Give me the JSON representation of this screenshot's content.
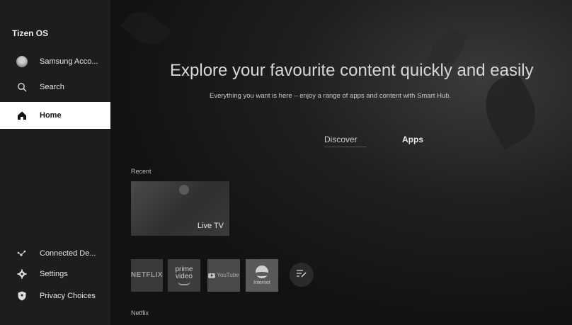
{
  "sidebar": {
    "os_title": "Tizen OS",
    "account_label": "Samsung Acco...",
    "search_label": "Search",
    "home_label": "Home",
    "connected_label": "Connected De...",
    "settings_label": "Settings",
    "privacy_label": "Privacy Choices"
  },
  "hero": {
    "title": "Explore your favourite content quickly and easily",
    "subtitle": "Everything you want is here – enjoy a range of apps and content with Smart Hub."
  },
  "tabs": {
    "discover": "Discover",
    "apps": "Apps"
  },
  "recent": {
    "section_label": "Recent",
    "live_tv_label": "Live TV"
  },
  "apps_row": {
    "netflix": "NETFLIX",
    "prime_line1": "prime",
    "prime_line2": "video",
    "youtube": "YouTube",
    "internet": "Internet"
  },
  "next_section_label": "Netflix",
  "colors": {
    "sidebar_bg": "#1d1d1d",
    "main_bg": "#141414",
    "active_item_bg": "#ffffff"
  },
  "icons": {
    "account": "avatar",
    "search": "search-icon",
    "home": "home-icon",
    "connected": "connected-devices-icon",
    "settings": "gear-icon",
    "privacy": "shield-icon",
    "edit": "edit-list-icon"
  }
}
